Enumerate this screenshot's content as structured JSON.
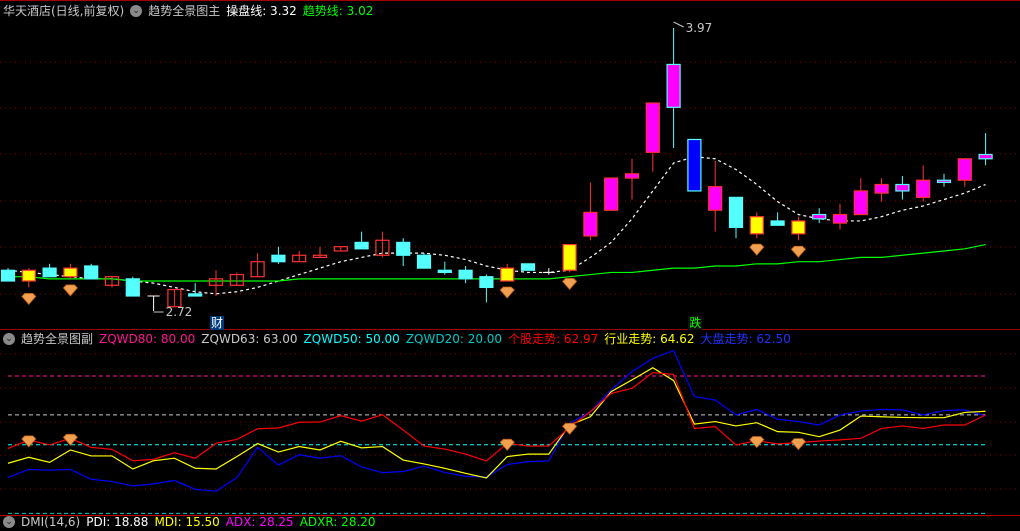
{
  "main_header": {
    "stock": "华天酒店(日线,前复权)",
    "indicator": "趋势全景图主",
    "op_line_label": "操盘线: 3.32",
    "trend_line_label": "趋势线: 3.02"
  },
  "sub_header": {
    "indicator": "趋势全景图副",
    "zqwd80": "ZQWD80: 80.00",
    "zqwd63": "ZQWD63: 63.00",
    "zqwd50": "ZQWD50: 50.00",
    "zqwd20": "ZQWD20: 20.00",
    "stock_trend": "个股走势: 62.97",
    "industry_trend": "行业走势: 64.62",
    "market_trend": "大盘走势: 62.50"
  },
  "dmi_header": {
    "name": "DMI(14,6)",
    "pdi": "PDI: 18.88",
    "mdi": "MDI: 15.50",
    "adx": "ADX: 28.25",
    "adxr": "ADXR: 28.20"
  },
  "tags": {
    "cai": "财",
    "die": "跌"
  },
  "colors": {
    "up_yellow": "#FFFF00",
    "up_magenta": "#FF00FF",
    "down_cyan": "#54FFFF",
    "down_blue": "#0000FF",
    "hollow_red": "#FF3232",
    "ma_green": "#00FF00",
    "stock": "#FF0000",
    "industry": "#FFFF00",
    "market": "#0000FF"
  },
  "chart_data": [
    {
      "type": "candlestick",
      "title": "趋势全景图主",
      "high_label": "3.97",
      "low_label": "2.72",
      "ylim": [
        2.62,
        3.99
      ],
      "candles_fields": [
        "open",
        "close",
        "high",
        "low",
        "style"
      ],
      "candles": [
        [
          2.84,
          2.79,
          2.85,
          2.79,
          "c"
        ],
        [
          2.79,
          2.84,
          2.85,
          2.76,
          "y"
        ],
        [
          2.85,
          2.81,
          2.87,
          2.81,
          "c"
        ],
        [
          2.81,
          2.85,
          2.87,
          2.8,
          "y"
        ],
        [
          2.86,
          2.8,
          2.87,
          2.8,
          "c"
        ],
        [
          2.77,
          2.81,
          2.81,
          2.76,
          "r"
        ],
        [
          2.8,
          2.72,
          2.81,
          2.72,
          "c"
        ],
        [
          2.72,
          2.72,
          2.72,
          2.65,
          "d"
        ],
        [
          2.67,
          2.75,
          2.75,
          2.67,
          "r"
        ],
        [
          2.73,
          2.72,
          2.78,
          2.72,
          "c"
        ],
        [
          2.77,
          2.8,
          2.84,
          2.72,
          "r"
        ],
        [
          2.77,
          2.82,
          2.83,
          2.77,
          "r"
        ],
        [
          2.81,
          2.88,
          2.92,
          2.81,
          "r"
        ],
        [
          2.91,
          2.88,
          2.95,
          2.87,
          "c"
        ],
        [
          2.88,
          2.91,
          2.93,
          2.88,
          "r"
        ],
        [
          2.9,
          2.91,
          2.95,
          2.9,
          "r"
        ],
        [
          2.93,
          2.95,
          2.95,
          2.93,
          "r"
        ],
        [
          2.97,
          2.94,
          3.02,
          2.94,
          "c"
        ],
        [
          2.91,
          2.98,
          3.02,
          2.9,
          "r"
        ],
        [
          2.97,
          2.91,
          2.99,
          2.86,
          "c"
        ],
        [
          2.91,
          2.85,
          2.92,
          2.85,
          "c"
        ],
        [
          2.84,
          2.83,
          2.88,
          2.82,
          "c"
        ],
        [
          2.84,
          2.8,
          2.86,
          2.78,
          "c"
        ],
        [
          2.81,
          2.76,
          2.82,
          2.69,
          "c"
        ],
        [
          2.79,
          2.85,
          2.87,
          2.79,
          "y"
        ],
        [
          2.87,
          2.84,
          2.87,
          2.84,
          "c"
        ],
        [
          2.83,
          2.83,
          2.85,
          2.82,
          "d"
        ],
        [
          2.84,
          2.96,
          2.96,
          2.83,
          "y"
        ],
        [
          3.0,
          3.11,
          3.25,
          2.98,
          "m"
        ],
        [
          3.12,
          3.27,
          3.27,
          3.12,
          "m"
        ],
        [
          3.27,
          3.29,
          3.36,
          3.17,
          "m"
        ],
        [
          3.39,
          3.62,
          3.62,
          3.3,
          "m"
        ],
        [
          3.6,
          3.8,
          3.97,
          3.41,
          "mc"
        ],
        [
          3.45,
          3.21,
          3.45,
          3.21,
          "b"
        ],
        [
          3.12,
          3.23,
          3.35,
          3.02,
          "m"
        ],
        [
          3.18,
          3.04,
          3.18,
          2.99,
          "c"
        ],
        [
          3.01,
          3.09,
          3.11,
          2.99,
          "y"
        ],
        [
          3.07,
          3.05,
          3.11,
          3.05,
          "c"
        ],
        [
          3.01,
          3.07,
          3.09,
          2.98,
          "y"
        ],
        [
          3.08,
          3.1,
          3.13,
          3.06,
          "mc"
        ],
        [
          3.06,
          3.1,
          3.15,
          3.03,
          "m"
        ],
        [
          3.1,
          3.21,
          3.27,
          3.1,
          "m"
        ],
        [
          3.2,
          3.24,
          3.27,
          3.16,
          "m"
        ],
        [
          3.21,
          3.24,
          3.28,
          3.17,
          "mc"
        ],
        [
          3.18,
          3.26,
          3.33,
          3.16,
          "m"
        ],
        [
          3.25,
          3.26,
          3.29,
          3.23,
          "mc"
        ],
        [
          3.26,
          3.36,
          3.36,
          3.23,
          "m"
        ],
        [
          3.36,
          3.38,
          3.48,
          3.33,
          "mc"
        ]
      ],
      "series": [
        {
          "name": "操盘线",
          "style": "white-dashed",
          "values": [
            2.84,
            2.83,
            2.82,
            2.81,
            2.8,
            2.8,
            2.79,
            2.78,
            2.76,
            2.74,
            2.73,
            2.74,
            2.76,
            2.79,
            2.82,
            2.85,
            2.88,
            2.9,
            2.92,
            2.92,
            2.92,
            2.91,
            2.89,
            2.86,
            2.84,
            2.83,
            2.83,
            2.84,
            2.9,
            2.97,
            3.08,
            3.21,
            3.34,
            3.37,
            3.36,
            3.31,
            3.24,
            3.16,
            3.1,
            3.08,
            3.07,
            3.07,
            3.09,
            3.12,
            3.14,
            3.17,
            3.2,
            3.24
          ]
        },
        {
          "name": "趋势线",
          "style": "green",
          "values": [
            2.81,
            2.81,
            2.8,
            2.8,
            2.8,
            2.8,
            2.79,
            2.79,
            2.79,
            2.79,
            2.79,
            2.79,
            2.79,
            2.79,
            2.8,
            2.8,
            2.8,
            2.8,
            2.8,
            2.8,
            2.8,
            2.8,
            2.8,
            2.8,
            2.8,
            2.8,
            2.8,
            2.81,
            2.82,
            2.83,
            2.83,
            2.84,
            2.85,
            2.85,
            2.86,
            2.86,
            2.87,
            2.87,
            2.88,
            2.88,
            2.89,
            2.9,
            2.9,
            2.91,
            2.92,
            2.93,
            2.94,
            2.96
          ]
        }
      ],
      "signal_markers": [
        1,
        3,
        24,
        27,
        36,
        38
      ],
      "tag_positions": {
        "cai": 10,
        "die": 33
      }
    },
    {
      "type": "line",
      "title": "趋势全景图副",
      "ylim": [
        17,
        92
      ],
      "reference_lines": [
        80,
        63,
        50,
        20
      ],
      "series": [
        {
          "name": "个股走势",
          "values": [
            48.3,
            52.1,
            49.9,
            52.8,
            48.8,
            48.0,
            43.0,
            43.6,
            46.5,
            44.1,
            50.6,
            52.3,
            57.0,
            57.3,
            59.8,
            59.9,
            62.7,
            60.3,
            63.1,
            56.4,
            49.4,
            48.1,
            45.9,
            42.9,
            50.6,
            49.4,
            49.4,
            57.6,
            64.4,
            72.4,
            74.6,
            81.5,
            80.7,
            57.1,
            57.9,
            49.9,
            51.8,
            50.3,
            50.9,
            51.6,
            52.1,
            52.8,
            57.1,
            58.2,
            57.1,
            58.6,
            58.6,
            62.97
          ]
        },
        {
          "name": "行业走势",
          "values": [
            41.9,
            44.5,
            42.3,
            47.7,
            45.1,
            45.1,
            39.4,
            43.0,
            44.1,
            39.7,
            39.4,
            44.8,
            50.5,
            46.8,
            49.2,
            47.7,
            51.5,
            48.6,
            49.2,
            43.3,
            41.6,
            39.7,
            37.5,
            35.5,
            44.8,
            45.9,
            45.9,
            58.6,
            62.2,
            73.2,
            78.3,
            83.6,
            78.0,
            59.0,
            60.1,
            58.2,
            59.6,
            55.7,
            55.4,
            53.5,
            56.4,
            62.5,
            62.2,
            61.9,
            61.8,
            61.8,
            64.1,
            64.62
          ]
        },
        {
          "name": "大盘走势",
          "values": [
            35.7,
            39.2,
            38.9,
            39.2,
            34.9,
            33.9,
            32.0,
            32.9,
            34.4,
            30.5,
            29.7,
            35.6,
            48.8,
            41.1,
            45.6,
            44.1,
            45.2,
            40.3,
            37.8,
            38.3,
            40.6,
            37.9,
            36.2,
            35.9,
            41.3,
            42.6,
            42.9,
            59.3,
            64.4,
            73.9,
            81.9,
            87.7,
            91.1,
            71.0,
            69.5,
            63.0,
            65.4,
            61.1,
            60.1,
            58.6,
            63.0,
            64.7,
            65.4,
            65.2,
            63.0,
            64.9,
            65.2,
            62.5
          ]
        }
      ],
      "signal_markers": [
        1,
        3,
        24,
        27,
        36,
        38
      ]
    }
  ]
}
